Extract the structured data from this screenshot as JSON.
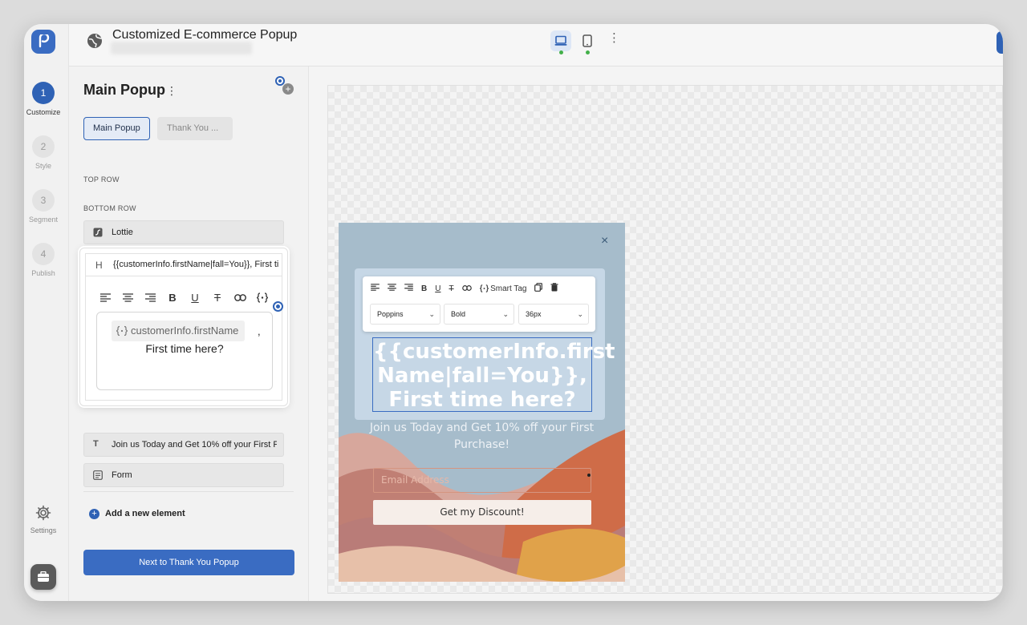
{
  "app": {
    "title": "Customized E-commerce Popup"
  },
  "steps": [
    {
      "num": "1",
      "label": "Customize"
    },
    {
      "num": "2",
      "label": "Style"
    },
    {
      "num": "3",
      "label": "Segment"
    },
    {
      "num": "4",
      "label": "Publish"
    }
  ],
  "rail": {
    "settings_label": "Settings"
  },
  "panel": {
    "title": "Main Popup",
    "tabs": [
      "Main Popup",
      "Thank You ..."
    ],
    "top_row_label": "TOP ROW",
    "bottom_row_label": "BOTTOM ROW",
    "items": {
      "lottie": "Lottie",
      "heading_text": "{{customerInfo.firstName|fall=You}}, First time here?",
      "heading_prefix": "H",
      "text_item": "Join us Today and Get 10% off your First Purchase!",
      "form": "Form"
    },
    "editor": {
      "chip": "customerInfo.firstName",
      "comma": ",",
      "line2": "First time here?"
    },
    "add_element": "Add a new element",
    "next_button": "Next to Thank You Popup"
  },
  "popup": {
    "close": "×",
    "toolbar": {
      "smart_tag": "Smart Tag",
      "font": "Poppins",
      "weight": "Bold",
      "size": "36px"
    },
    "headline": "{{customerInfo.first Name|fall=You}}, First time here?",
    "subtext": "Join us Today and Get 10% off your First Purchase!",
    "email_placeholder": "Email Address",
    "cta": "Get my Discount!"
  },
  "colors": {
    "accent": "#2f62b5",
    "popup_bg": "#a6bccb"
  }
}
